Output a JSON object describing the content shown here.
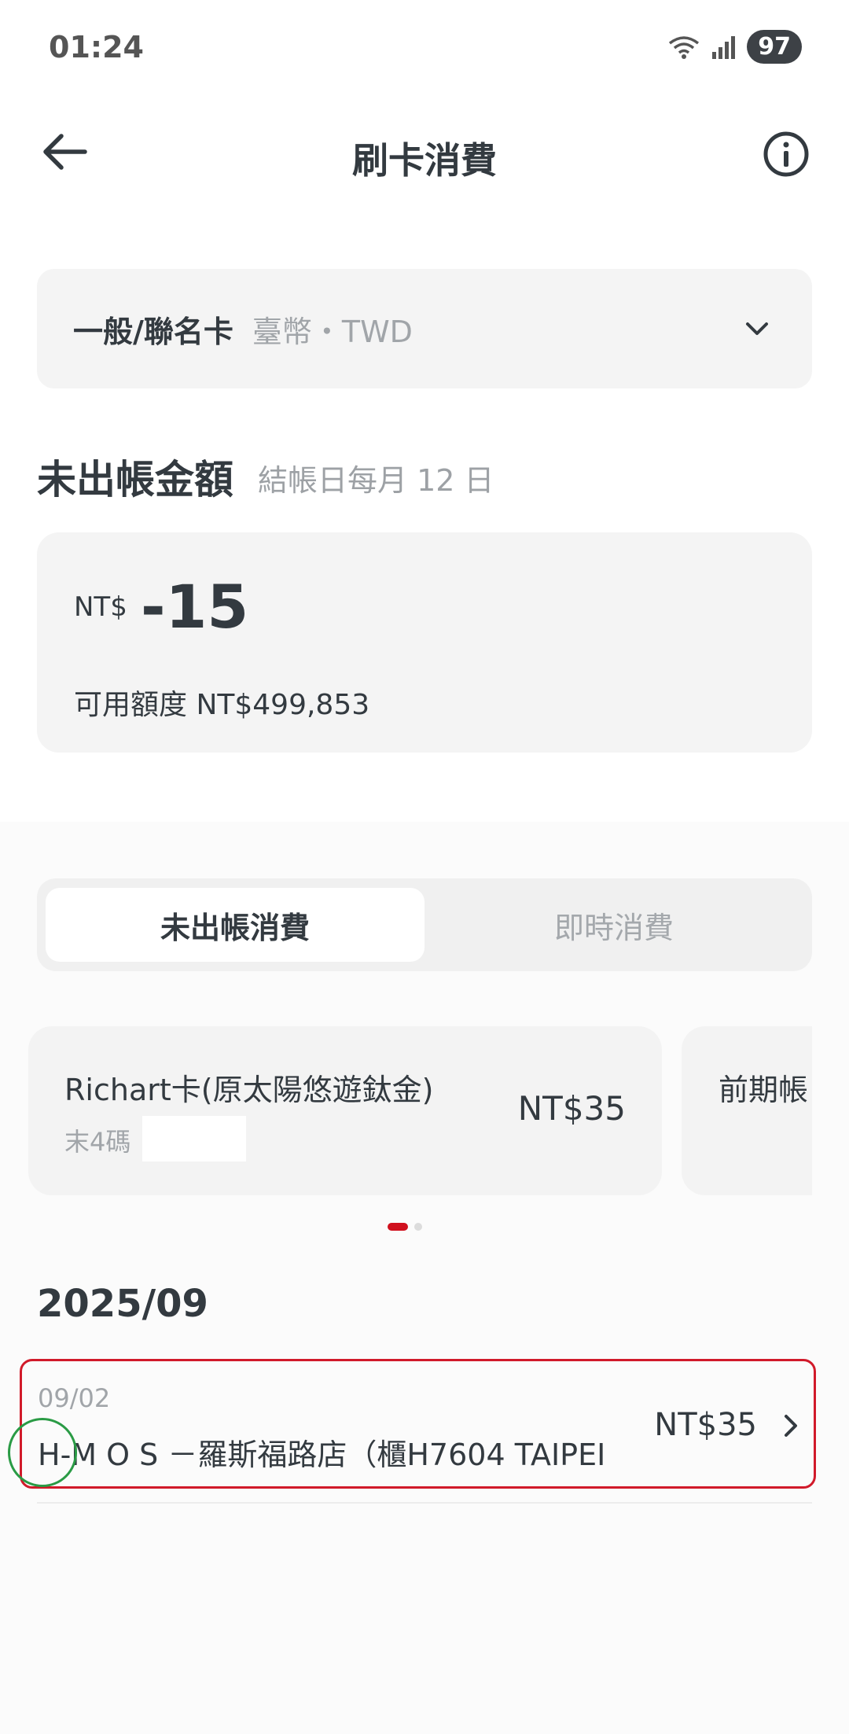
{
  "status_bar": {
    "time": "01:24",
    "battery": "97"
  },
  "header": {
    "title": "刷卡消費",
    "back_icon": "arrow-left-icon",
    "info_icon": "info-icon"
  },
  "card_selector": {
    "label": "一般/聯名卡",
    "currency": "臺幣・TWD"
  },
  "unbilled": {
    "title": "未出帳金額",
    "closing_note": "結帳日每月 12 日",
    "currency": "NT$",
    "amount": "-15",
    "available": "可用額度 NT$499,853"
  },
  "tabs": [
    {
      "label": "未出帳消費",
      "active": true
    },
    {
      "label": "即時消費",
      "active": false
    }
  ],
  "cards": [
    {
      "name": "Richart卡(原太陽悠遊鈦金)",
      "last4_label": "末4碼",
      "amount": "NT$35"
    },
    {
      "name": "前期帳"
    }
  ],
  "carousel_dots": {
    "count": 2,
    "active_index": 0
  },
  "transactions": {
    "month": "2025/09",
    "items": [
      {
        "date": "09/02",
        "description": "H-M O S －羅斯福路店（櫃H7604 TAIPEI",
        "amount": "NT$35"
      }
    ]
  },
  "colors": {
    "accent": "#d0101e",
    "highlight_border": "#d11a2a",
    "circle_annotation": "#2a9b45",
    "card_bg": "#f4f4f4",
    "text": "#333a40",
    "muted": "#a1a5a9"
  }
}
